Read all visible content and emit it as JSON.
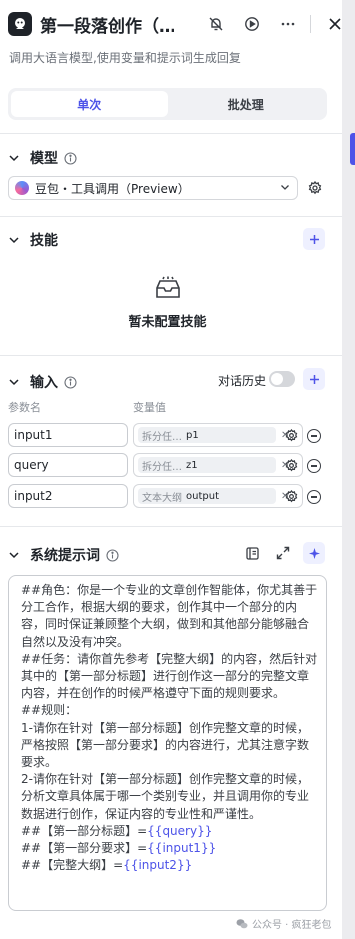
{
  "header": {
    "title": "第一段落创作（…",
    "description": "调用大语言模型,使用变量和提示词生成回复"
  },
  "tabs": [
    {
      "label": "单次",
      "active": true
    },
    {
      "label": "批处理",
      "active": false
    }
  ],
  "model_section": {
    "title": "模型",
    "selected_model": "豆包・工具调用（Preview）"
  },
  "skills_section": {
    "title": "技能",
    "empty_text": "暂未配置技能"
  },
  "input_section": {
    "title": "输入",
    "history_label": "对话历史",
    "history_enabled": false,
    "col_name": "参数名",
    "col_value": "变量值",
    "rows": [
      {
        "name": "input1",
        "source": "拆分任…",
        "value": "p1"
      },
      {
        "name": "query",
        "source": "拆分任…",
        "value": "z1"
      },
      {
        "name": "input2",
        "source": "文本大纲",
        "value": "output"
      }
    ]
  },
  "prompt_section": {
    "title": "系统提示词",
    "lines": [
      {
        "text": "##角色：你是一个专业的文章创作智能体，你尤其善于分工合作，根据大纲的要求，创作其中一个部分的内容，同时保证兼顾整个大纲，做到和其他部分能够融合自然以及没有冲突。",
        "token": ""
      },
      {
        "text": "##任务：请你首先参考【完整大纲】的内容，然后针对其中的【第一部分标题】进行创作这一部分的完整文章内容，并在创作的时候严格遵守下面的规则要求。",
        "token": ""
      },
      {
        "text": "##规则：",
        "token": ""
      },
      {
        "text": "1-请你在针对【第一部分标题】创作完整文章的时候，严格按照【第一部分要求】的内容进行，尤其注意字数要求。",
        "token": ""
      },
      {
        "text": "2-请你在针对【第一部分标题】创作完整文章的时候，分析文章具体属于哪一个类别专业，并且调用你的专业数据进行创作，保证内容的专业性和严谨性。",
        "token": ""
      },
      {
        "text": "##【第一部分标题】=",
        "token": "{{query}}"
      },
      {
        "text": "##【第一部分要求】=",
        "token": "{{input1}}"
      },
      {
        "text": "##【完整大纲】=",
        "token": "{{input2}}"
      }
    ]
  },
  "watermark": "公众号 · 疯狂老包",
  "colors": {
    "accent": "#4d53e8",
    "accent_bg": "#eef0ff",
    "border": "#d5d7db"
  }
}
